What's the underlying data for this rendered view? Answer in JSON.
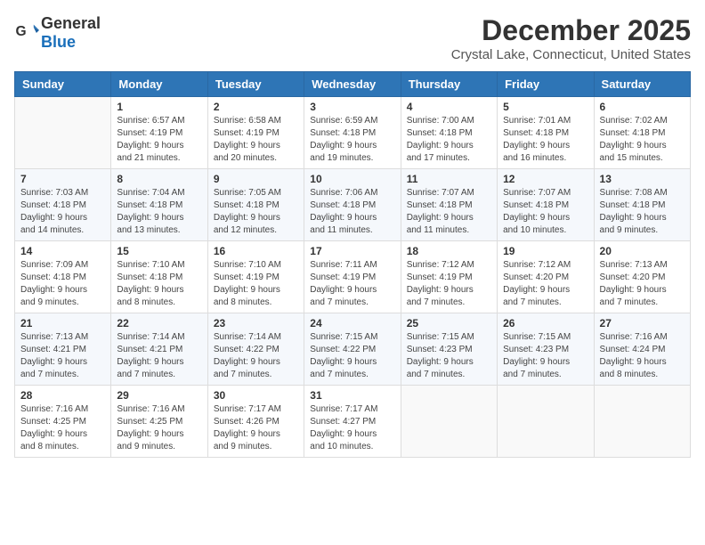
{
  "logo": {
    "general": "General",
    "blue": "Blue"
  },
  "title": "December 2025",
  "subtitle": "Crystal Lake, Connecticut, United States",
  "weekdays": [
    "Sunday",
    "Monday",
    "Tuesday",
    "Wednesday",
    "Thursday",
    "Friday",
    "Saturday"
  ],
  "weeks": [
    [
      {
        "day": "",
        "info": ""
      },
      {
        "day": "1",
        "info": "Sunrise: 6:57 AM\nSunset: 4:19 PM\nDaylight: 9 hours\nand 21 minutes."
      },
      {
        "day": "2",
        "info": "Sunrise: 6:58 AM\nSunset: 4:19 PM\nDaylight: 9 hours\nand 20 minutes."
      },
      {
        "day": "3",
        "info": "Sunrise: 6:59 AM\nSunset: 4:18 PM\nDaylight: 9 hours\nand 19 minutes."
      },
      {
        "day": "4",
        "info": "Sunrise: 7:00 AM\nSunset: 4:18 PM\nDaylight: 9 hours\nand 17 minutes."
      },
      {
        "day": "5",
        "info": "Sunrise: 7:01 AM\nSunset: 4:18 PM\nDaylight: 9 hours\nand 16 minutes."
      },
      {
        "day": "6",
        "info": "Sunrise: 7:02 AM\nSunset: 4:18 PM\nDaylight: 9 hours\nand 15 minutes."
      }
    ],
    [
      {
        "day": "7",
        "info": "Sunrise: 7:03 AM\nSunset: 4:18 PM\nDaylight: 9 hours\nand 14 minutes."
      },
      {
        "day": "8",
        "info": "Sunrise: 7:04 AM\nSunset: 4:18 PM\nDaylight: 9 hours\nand 13 minutes."
      },
      {
        "day": "9",
        "info": "Sunrise: 7:05 AM\nSunset: 4:18 PM\nDaylight: 9 hours\nand 12 minutes."
      },
      {
        "day": "10",
        "info": "Sunrise: 7:06 AM\nSunset: 4:18 PM\nDaylight: 9 hours\nand 11 minutes."
      },
      {
        "day": "11",
        "info": "Sunrise: 7:07 AM\nSunset: 4:18 PM\nDaylight: 9 hours\nand 11 minutes."
      },
      {
        "day": "12",
        "info": "Sunrise: 7:07 AM\nSunset: 4:18 PM\nDaylight: 9 hours\nand 10 minutes."
      },
      {
        "day": "13",
        "info": "Sunrise: 7:08 AM\nSunset: 4:18 PM\nDaylight: 9 hours\nand 9 minutes."
      }
    ],
    [
      {
        "day": "14",
        "info": "Sunrise: 7:09 AM\nSunset: 4:18 PM\nDaylight: 9 hours\nand 9 minutes."
      },
      {
        "day": "15",
        "info": "Sunrise: 7:10 AM\nSunset: 4:18 PM\nDaylight: 9 hours\nand 8 minutes."
      },
      {
        "day": "16",
        "info": "Sunrise: 7:10 AM\nSunset: 4:19 PM\nDaylight: 9 hours\nand 8 minutes."
      },
      {
        "day": "17",
        "info": "Sunrise: 7:11 AM\nSunset: 4:19 PM\nDaylight: 9 hours\nand 7 minutes."
      },
      {
        "day": "18",
        "info": "Sunrise: 7:12 AM\nSunset: 4:19 PM\nDaylight: 9 hours\nand 7 minutes."
      },
      {
        "day": "19",
        "info": "Sunrise: 7:12 AM\nSunset: 4:20 PM\nDaylight: 9 hours\nand 7 minutes."
      },
      {
        "day": "20",
        "info": "Sunrise: 7:13 AM\nSunset: 4:20 PM\nDaylight: 9 hours\nand 7 minutes."
      }
    ],
    [
      {
        "day": "21",
        "info": "Sunrise: 7:13 AM\nSunset: 4:21 PM\nDaylight: 9 hours\nand 7 minutes."
      },
      {
        "day": "22",
        "info": "Sunrise: 7:14 AM\nSunset: 4:21 PM\nDaylight: 9 hours\nand 7 minutes."
      },
      {
        "day": "23",
        "info": "Sunrise: 7:14 AM\nSunset: 4:22 PM\nDaylight: 9 hours\nand 7 minutes."
      },
      {
        "day": "24",
        "info": "Sunrise: 7:15 AM\nSunset: 4:22 PM\nDaylight: 9 hours\nand 7 minutes."
      },
      {
        "day": "25",
        "info": "Sunrise: 7:15 AM\nSunset: 4:23 PM\nDaylight: 9 hours\nand 7 minutes."
      },
      {
        "day": "26",
        "info": "Sunrise: 7:15 AM\nSunset: 4:23 PM\nDaylight: 9 hours\nand 7 minutes."
      },
      {
        "day": "27",
        "info": "Sunrise: 7:16 AM\nSunset: 4:24 PM\nDaylight: 9 hours\nand 8 minutes."
      }
    ],
    [
      {
        "day": "28",
        "info": "Sunrise: 7:16 AM\nSunset: 4:25 PM\nDaylight: 9 hours\nand 8 minutes."
      },
      {
        "day": "29",
        "info": "Sunrise: 7:16 AM\nSunset: 4:25 PM\nDaylight: 9 hours\nand 9 minutes."
      },
      {
        "day": "30",
        "info": "Sunrise: 7:17 AM\nSunset: 4:26 PM\nDaylight: 9 hours\nand 9 minutes."
      },
      {
        "day": "31",
        "info": "Sunrise: 7:17 AM\nSunset: 4:27 PM\nDaylight: 9 hours\nand 10 minutes."
      },
      {
        "day": "",
        "info": ""
      },
      {
        "day": "",
        "info": ""
      },
      {
        "day": "",
        "info": ""
      }
    ]
  ]
}
